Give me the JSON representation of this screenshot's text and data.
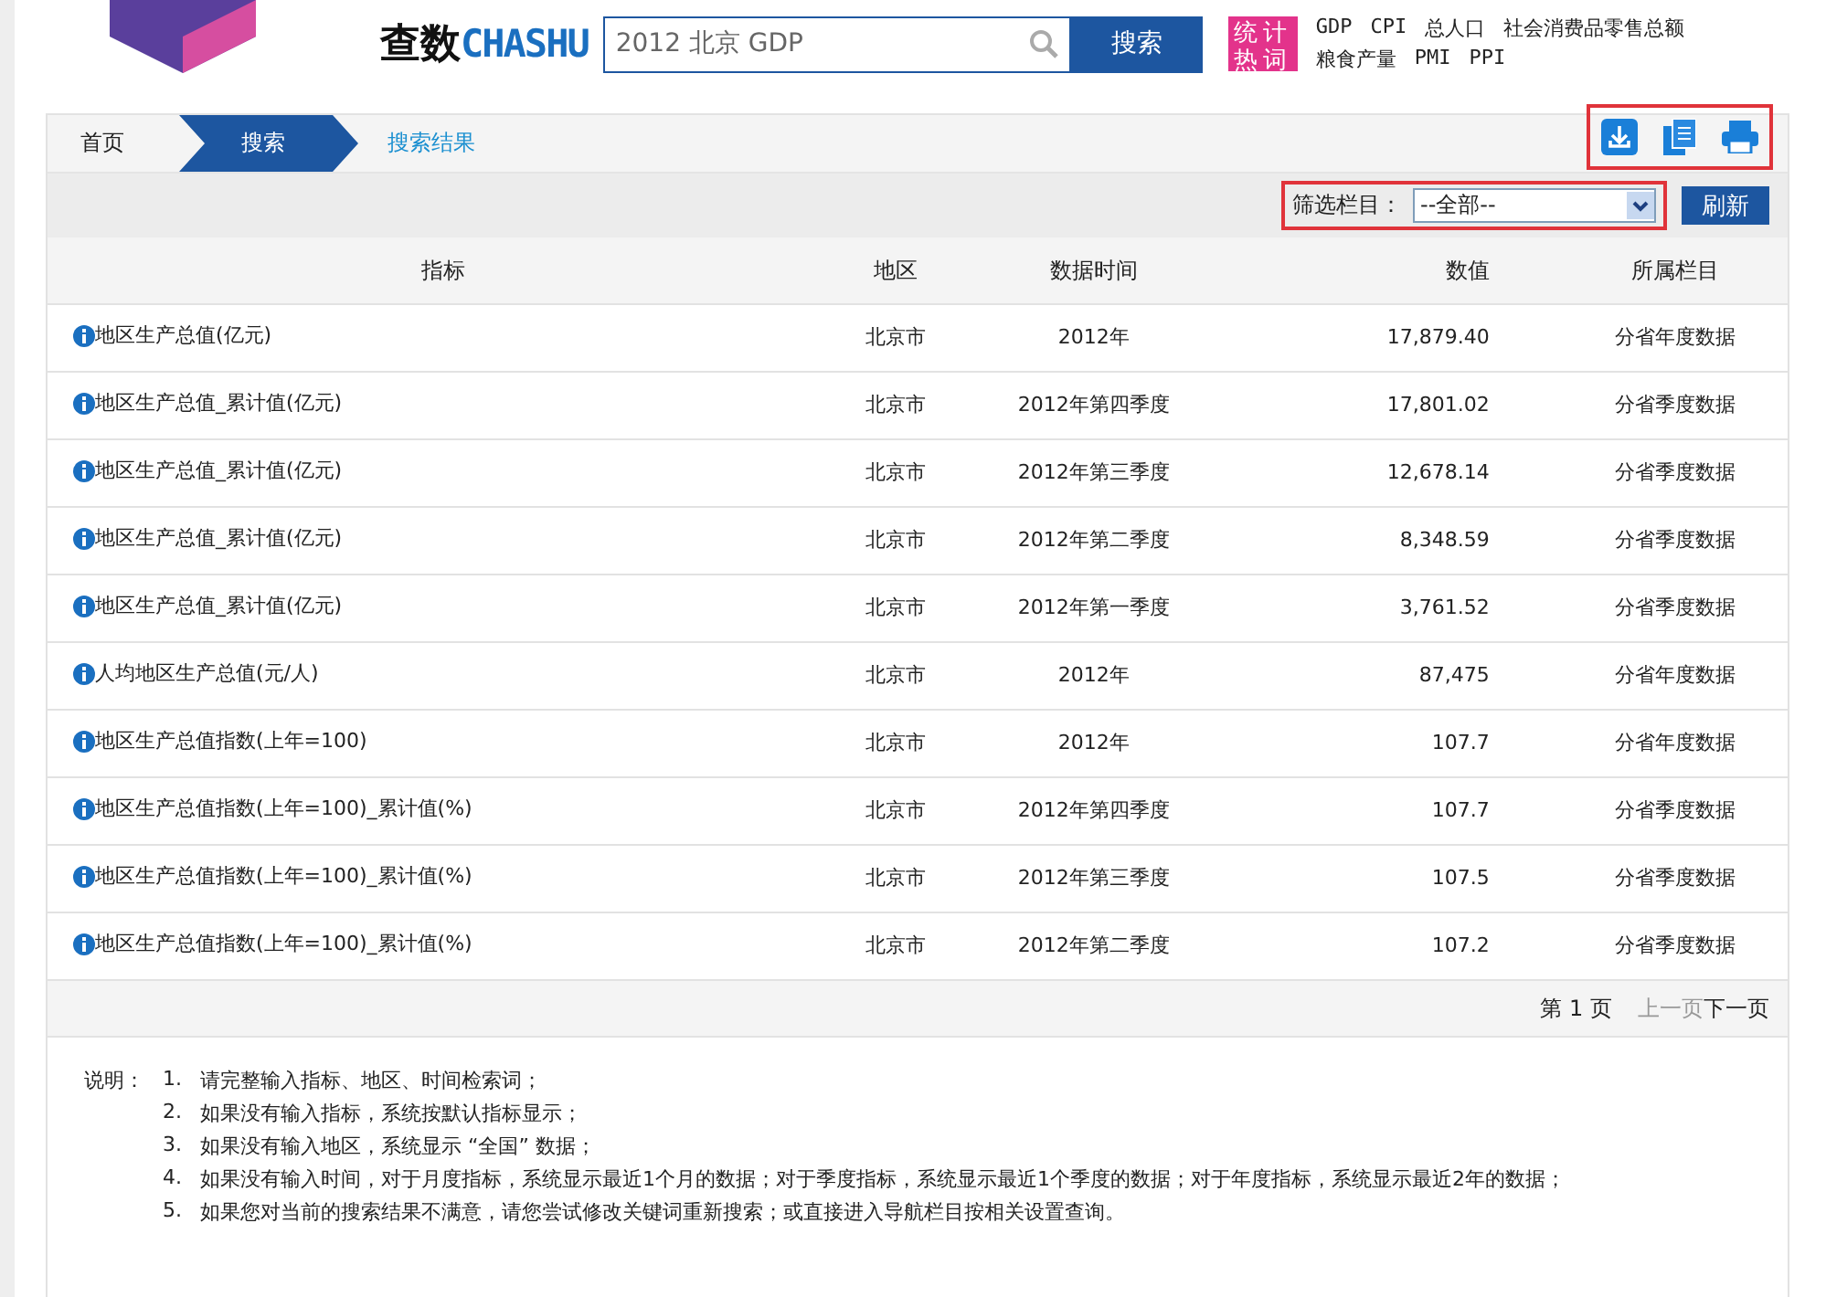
{
  "header": {
    "logo_cn": "查数",
    "logo_en": "CHASHU",
    "search": {
      "value": "2012 北京 GDP"
    },
    "search_button": "搜索",
    "hot_badge": "统计热词",
    "hot_words": [
      "GDP",
      "CPI",
      "总人口",
      "社会消费品零售总额",
      "粮食产量",
      "PMI",
      "PPI"
    ]
  },
  "breadcrumb": [
    {
      "label": "首页",
      "kind": "home"
    },
    {
      "label": "搜索",
      "kind": "active"
    },
    {
      "label": "搜索结果",
      "kind": "current"
    }
  ],
  "filter": {
    "label": "筛选栏目：",
    "value": "--全部--",
    "button": "刷新"
  },
  "table": {
    "columns": [
      "指标",
      "地区",
      "数据时间",
      "数值",
      "所属栏目"
    ],
    "rows": [
      [
        "地区生产总值(亿元)",
        "北京市",
        "2012年",
        "17,879.40",
        "分省年度数据"
      ],
      [
        "地区生产总值_累计值(亿元)",
        "北京市",
        "2012年第四季度",
        "17,801.02",
        "分省季度数据"
      ],
      [
        "地区生产总值_累计值(亿元)",
        "北京市",
        "2012年第三季度",
        "12,678.14",
        "分省季度数据"
      ],
      [
        "地区生产总值_累计值(亿元)",
        "北京市",
        "2012年第二季度",
        "8,348.59",
        "分省季度数据"
      ],
      [
        "地区生产总值_累计值(亿元)",
        "北京市",
        "2012年第一季度",
        "3,761.52",
        "分省季度数据"
      ],
      [
        "人均地区生产总值(元/人)",
        "北京市",
        "2012年",
        "87,475",
        "分省年度数据"
      ],
      [
        "地区生产总值指数(上年=100)",
        "北京市",
        "2012年",
        "107.7",
        "分省年度数据"
      ],
      [
        "地区生产总值指数(上年=100)_累计值(%)",
        "北京市",
        "2012年第四季度",
        "107.7",
        "分省季度数据"
      ],
      [
        "地区生产总值指数(上年=100)_累计值(%)",
        "北京市",
        "2012年第三季度",
        "107.5",
        "分省季度数据"
      ],
      [
        "地区生产总值指数(上年=100)_累计值(%)",
        "北京市",
        "2012年第二季度",
        "107.2",
        "分省季度数据"
      ]
    ]
  },
  "pager": {
    "page": "第 1 页",
    "links": [
      {
        "label": "上一页",
        "disabled": true
      },
      {
        "label": "下一页",
        "disabled": false
      }
    ]
  },
  "notes": {
    "label": "说明：",
    "items": [
      {
        "num": "1.",
        "text": "请完整输入指标、地区、时间检索词；"
      },
      {
        "num": "2.",
        "text": "如果没有输入指标，系统按默认指标显示；"
      },
      {
        "num": "3.",
        "text": "如果没有输入地区，系统显示 “全国” 数据；"
      },
      {
        "num": "4.",
        "text": "如果没有输入时间，对于月度指标，系统显示最近1个月的数据；对于季度指标，系统显示最近1个季度的数据；对于年度指标，系统显示最近2年的数据；"
      },
      {
        "num": "5.",
        "text": "如果您对当前的搜索结果不满意，请您尝试修改关键词重新搜索；或直接进入导航栏目按相关设置查询。"
      }
    ]
  }
}
